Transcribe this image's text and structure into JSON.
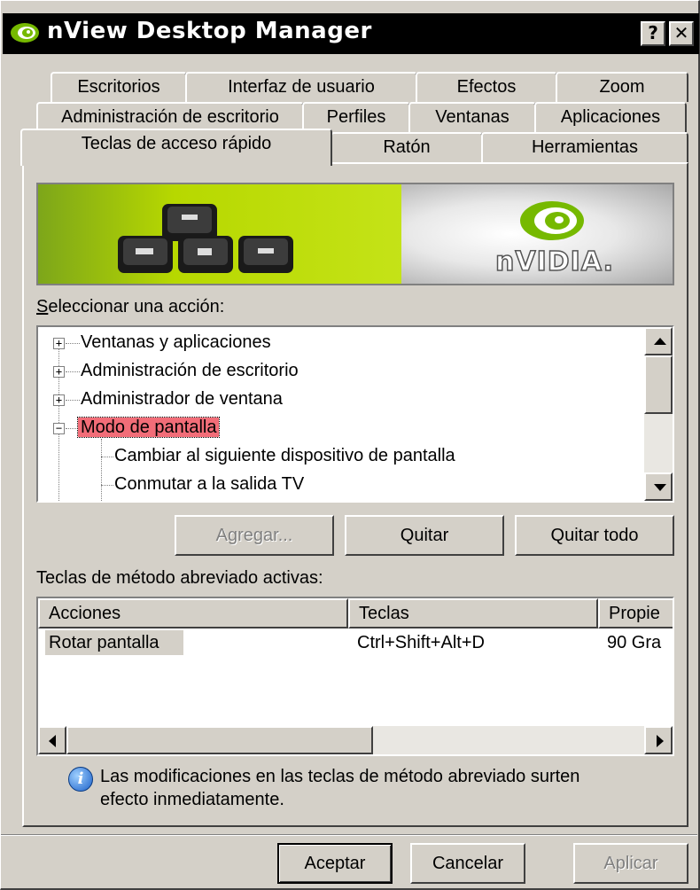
{
  "window": {
    "title": "nView Desktop Manager",
    "help_label": "?",
    "close_label": "✕"
  },
  "tabs": {
    "row1": [
      "Escritorios",
      "Interfaz de usuario",
      "Efectos",
      "Zoom"
    ],
    "row2": [
      "Administración de escritorio",
      "Perfiles",
      "Ventanas",
      "Aplicaciones"
    ],
    "row3": [
      "Teclas de acceso rápido",
      "Ratón",
      "Herramientas"
    ],
    "active": "Teclas de acceso rápido"
  },
  "banner": {
    "brand": "nVIDIA."
  },
  "action_section": {
    "label": "Seleccionar una acción:",
    "tree": [
      {
        "label": "Ventanas y aplicaciones",
        "expander": "+"
      },
      {
        "label": "Administración de escritorio",
        "expander": "+"
      },
      {
        "label": "Administrador de ventana",
        "expander": "+"
      },
      {
        "label": "Modo de pantalla",
        "expander": "−",
        "selected": true
      },
      {
        "label": "Cambiar al siguiente dispositivo de pantalla"
      },
      {
        "label": "Conmutar a la salida TV"
      }
    ]
  },
  "buttons": {
    "add": "Agregar...",
    "remove": "Quitar",
    "remove_all": "Quitar todo"
  },
  "active_section": {
    "label": "Teclas de método abreviado activas:",
    "columns": [
      "Acciones",
      "Teclas",
      "Propie"
    ],
    "rows": [
      {
        "action": "Rotar pantalla",
        "keys": "Ctrl+Shift+Alt+D",
        "props": "90 Gra"
      }
    ]
  },
  "info": {
    "line1": "Las modificaciones en las teclas de método abreviado surten",
    "line2": "efecto inmediatamente."
  },
  "footer": {
    "ok": "Aceptar",
    "cancel": "Cancelar",
    "apply": "Aplicar"
  },
  "colors": {
    "face": "#d4d0c8",
    "selection": "#f26d78",
    "banner_green": "#b7d800",
    "nvidia_green": "#76b900"
  }
}
